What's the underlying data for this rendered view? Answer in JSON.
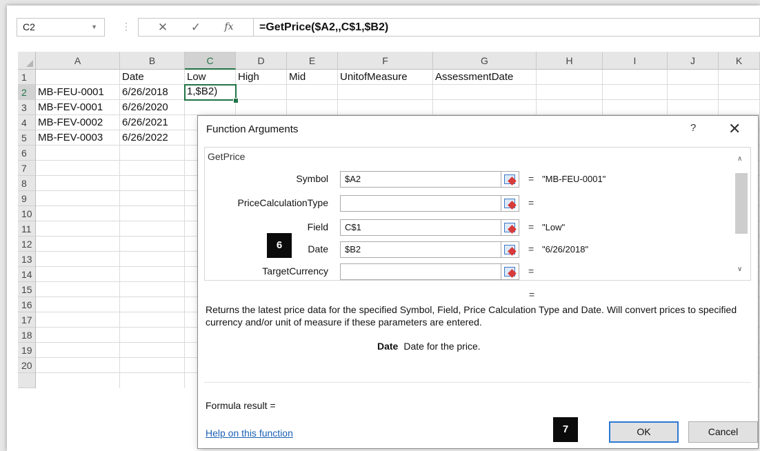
{
  "formula_bar": {
    "name_box": "C2",
    "cancel_glyph": "✕",
    "enter_glyph": "✓",
    "fx_label": "fx",
    "formula": "=GetPrice($A2,,C$1,$B2)"
  },
  "sheet": {
    "columns": [
      "A",
      "B",
      "C",
      "D",
      "E",
      "F",
      "G",
      "H",
      "I",
      "J",
      "K"
    ],
    "rows": [
      "1",
      "2",
      "3",
      "4",
      "5",
      "6",
      "7",
      "8",
      "9",
      "10",
      "11",
      "12",
      "13",
      "14",
      "15",
      "16",
      "17",
      "18",
      "19",
      "20"
    ],
    "headers": {
      "b": "Date",
      "c": "Low",
      "d": "High",
      "e": "Mid",
      "f": "UnitofMeasure",
      "g": "AssessmentDate"
    },
    "data": [
      {
        "a": "MB-FEU-0001",
        "b": "6/26/2018",
        "c": "1,$B2)"
      },
      {
        "a": "MB-FEV-0001",
        "b": "6/26/2020"
      },
      {
        "a": "MB-FEV-0002",
        "b": "6/26/2021"
      },
      {
        "a": "MB-FEV-0003",
        "b": "6/26/2022"
      }
    ]
  },
  "dialog": {
    "title": "Function Arguments",
    "help_glyph": "?",
    "close_glyph": "✕",
    "function_name": "GetPrice",
    "args": [
      {
        "label": "Symbol",
        "value": "$A2",
        "eq": "=",
        "result": "\"MB-FEU-0001\""
      },
      {
        "label": "PriceCalculationType",
        "value": "",
        "eq": "=",
        "result": ""
      },
      {
        "label": "Field",
        "value": "C$1",
        "eq": "=",
        "result": "\"Low\""
      },
      {
        "label": "Date",
        "value": "$B2",
        "eq": "=",
        "result": "\"6/26/2018\""
      },
      {
        "label": "TargetCurrency",
        "value": "",
        "eq": "=",
        "result": ""
      }
    ],
    "scroll_up": "∧",
    "scroll_down": "∨",
    "result_eq": "=",
    "description": "Returns the latest price data for the specified Symbol, Field, Price Calculation Type and Date. Will convert prices to specified currency and/or unit of measure if these parameters are entered.",
    "arg_help_name": "Date",
    "arg_help_text": "Date for the price.",
    "formula_result": "Formula result =",
    "help_link": "Help on this function",
    "ok": "OK",
    "cancel": "Cancel"
  },
  "badges": {
    "step6": "6",
    "step7": "7"
  }
}
